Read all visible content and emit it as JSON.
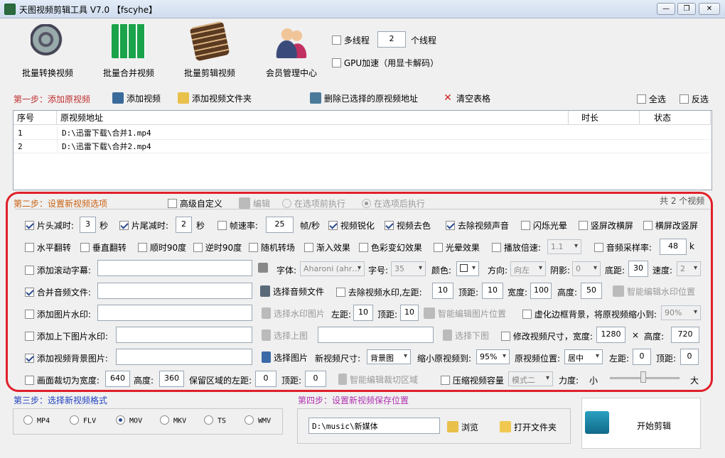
{
  "window": {
    "title": "天图视频剪辑工具 V7.0  【fscyhe】",
    "minimize": "—",
    "maximize": "❐",
    "close": "✕"
  },
  "toolbar": [
    {
      "label": "批量转换视频",
      "icon": "film-reel-icon"
    },
    {
      "label": "批量合并视频",
      "icon": "merge-grid-icon"
    },
    {
      "label": "批量剪辑视频",
      "icon": "film-scissors-icon"
    },
    {
      "label": "会员管理中心",
      "icon": "users-icon"
    }
  ],
  "threads": {
    "multi_label": "多线程",
    "count": "2",
    "unit": "个线程",
    "gpu_label": "GPU加速（用显卡解码）"
  },
  "step1": {
    "title": "第一步：添加原视频",
    "add_video": "添加视频",
    "add_folder": "添加视频文件夹",
    "delete_selected": "删除已选择的原视频地址",
    "clear_table": "清空表格",
    "select_all": "全选",
    "invert": "反选"
  },
  "table": {
    "headers": {
      "index": "序号",
      "path": "原视频地址",
      "duration": "时长",
      "status": "状态"
    },
    "rows": [
      {
        "index": "1",
        "path": "D:\\迅雷下载\\合并1.mp4",
        "duration": "",
        "status": ""
      },
      {
        "index": "2",
        "path": "D:\\迅雷下载\\合并2.mp4",
        "duration": "",
        "status": ""
      }
    ]
  },
  "step2": {
    "title": "第二步：设置新视频选项",
    "advanced": "高级自定义",
    "edit": "编辑",
    "before": "在选项前执行",
    "after": "在选项后执行",
    "count_text": "共 2 个视频",
    "row1": {
      "head_cut": "片头减时:",
      "head_val": "3",
      "sec1": "秒",
      "tail_cut": "片尾减时:",
      "tail_val": "2",
      "sec2": "秒",
      "fps": "帧速率:",
      "fps_val": "25",
      "fps_unit": "帧/秒",
      "sharpen": "视频锐化",
      "decolor": "视频去色",
      "mute": "去除视频声音",
      "flash": "闪烁光晕",
      "v2h": "竖屏改横屏",
      "h2v": "横屏改竖屏"
    },
    "row2": {
      "hflip": "水平翻转",
      "vflip": "垂直翻转",
      "cw90": "顺时90度",
      "ccw90": "逆时90度",
      "random": "随机转场",
      "fadein": "渐入效果",
      "colorfx": "色彩变幻效果",
      "halo": "光晕效果",
      "speed": "播放倍速:",
      "speed_val": "1.1",
      "sample": "音频采样率:",
      "sample_val": "48",
      "sample_unit": "k"
    },
    "row3": {
      "subtitle": "添加滚动字幕:",
      "font": "字体:",
      "font_val": "Aharoni (ahr…",
      "size": "字号:",
      "size_val": "35",
      "color": "颜色:",
      "direction": "方向:",
      "direction_val": "向左",
      "shadow": "阴影:",
      "shadow_val": "0",
      "bottom": "底距:",
      "bottom_val": "30",
      "spd": "速度:",
      "spd_val": "2"
    },
    "row4": {
      "merge_audio": "合并音频文件:",
      "choose_audio": "选择音频文件",
      "remove_wm": "去除视频水印,左距:",
      "left_val": "10",
      "top": "顶距:",
      "top_val": "10",
      "width": "宽度:",
      "width_val": "100",
      "height": "高度:",
      "height_val": "50",
      "smart_wm": "智能编辑水印位置"
    },
    "row5": {
      "img_wm": "添加图片水印:",
      "choose_img": "选择水印图片",
      "left": "左距:",
      "left_val": "10",
      "top": "顶距:",
      "top_val": "10",
      "smart_img": "智能编辑图片位置",
      "blur_bg": "虚化边框背景，将原视频缩小到:",
      "blur_val": "90%"
    },
    "row6": {
      "updown": "添加上下图片水印:",
      "choose_up": "选择上图",
      "choose_down": "选择下图",
      "resize": "修改视频尺寸，宽度:",
      "w_val": "1280",
      "times": "×",
      "h_label": "高度:",
      "h_val": "720"
    },
    "row7": {
      "bg_img": "添加视频背景图片:",
      "choose_pic": "选择图片",
      "new_size": "新视频尺寸:",
      "new_size_val": "背景图",
      "shrink": "缩小原视频到:",
      "shrink_val": "95%",
      "pos": "原视频位置:",
      "pos_val": "居中",
      "left": "左距:",
      "left_val": "0",
      "top": "顶距:",
      "top_val": "0"
    },
    "row8": {
      "crop": "画面裁切为宽度:",
      "crop_w": "640",
      "h_label": "高度:",
      "crop_h": "360",
      "keep_left": "保留区域的左距:",
      "keep_left_val": "0",
      "top": "顶距:",
      "top_val": "0",
      "smart_crop": "智能编辑裁切区域",
      "compress": "压缩视频容量",
      "mode_val": "模式二",
      "force": "力度:",
      "small": "小",
      "big": "大",
      "strength": 0.45
    }
  },
  "step3": {
    "title": "第三步：选择新视频格式",
    "formats": [
      "MP4",
      "FLV",
      "MOV",
      "MKV",
      "TS",
      "WMV"
    ],
    "selected": "MOV"
  },
  "step4": {
    "title": "第四步：设置新视频保存位置",
    "path": "D:\\music\\新媒体",
    "browse": "浏览",
    "open_folder": "打开文件夹"
  },
  "start": {
    "label": "开始剪辑"
  }
}
